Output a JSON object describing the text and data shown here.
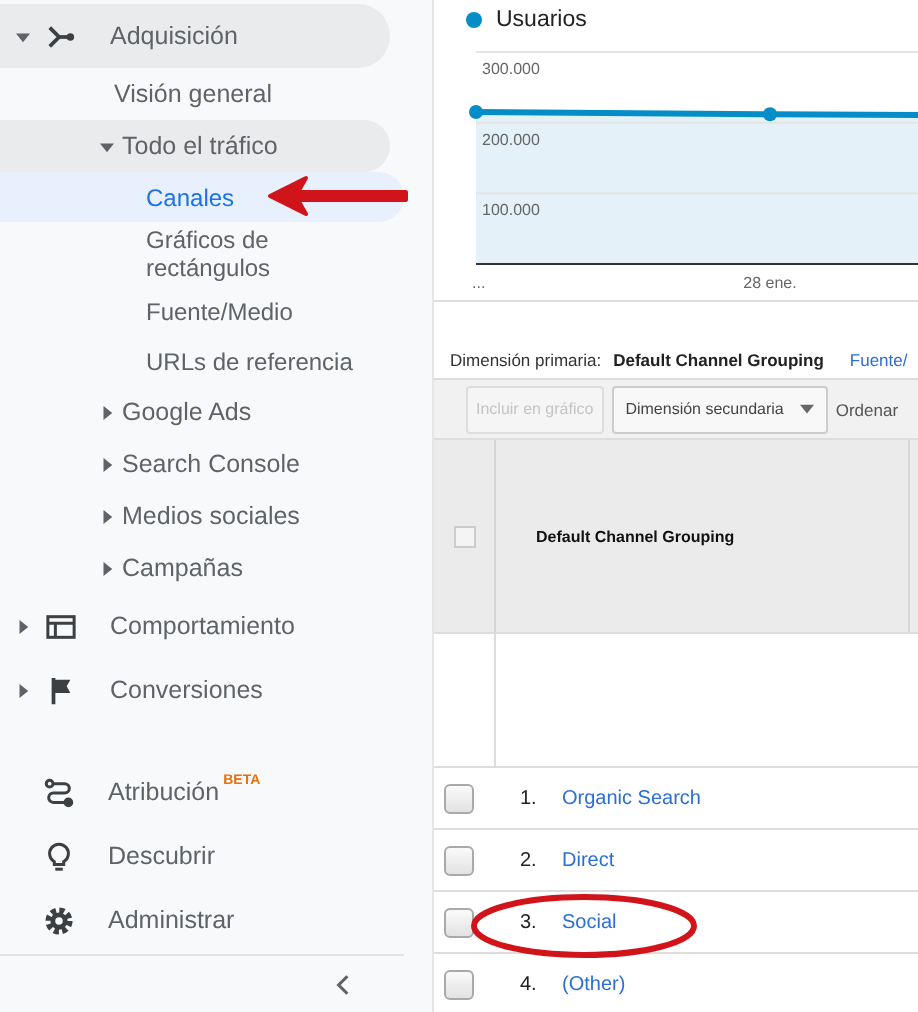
{
  "sidebar": {
    "items": [
      {
        "label": "Adquisición",
        "expanded": true,
        "selected": false,
        "children": [
          {
            "label": "Visión general",
            "selected": false
          },
          {
            "label": "Todo el tráfico",
            "expanded": true,
            "selected": false,
            "children": [
              {
                "label": "Canales",
                "selected": true
              },
              {
                "label": "Gráficos de rectángulos",
                "selected": false
              },
              {
                "label": "Fuente/Medio",
                "selected": false
              },
              {
                "label": "URLs de referencia",
                "selected": false
              }
            ]
          },
          {
            "label": "Google Ads",
            "expanded": false,
            "selected": false
          },
          {
            "label": "Search Console",
            "expanded": false,
            "selected": false
          },
          {
            "label": "Medios sociales",
            "expanded": false,
            "selected": false
          },
          {
            "label": "Campañas",
            "expanded": false,
            "selected": false
          }
        ]
      },
      {
        "label": "Comportamiento",
        "expanded": false,
        "selected": false
      },
      {
        "label": "Conversiones",
        "expanded": false,
        "selected": false
      }
    ],
    "tools": [
      {
        "label": "Atribución",
        "badge": "BETA",
        "selected": false
      },
      {
        "label": "Descubrir",
        "selected": false
      },
      {
        "label": "Administrar",
        "selected": false
      }
    ]
  },
  "chart": {
    "chart_data": {
      "type": "area",
      "categories": [
        "...",
        "28 ene.",
        null
      ],
      "ylim": [
        0,
        300000
      ],
      "grid": true,
      "series": [
        {
          "name": "Usuarios",
          "color": "#058dc7",
          "values": [
            215000,
            212000,
            210000
          ]
        }
      ],
      "yticks": [
        {
          "value": 100000,
          "label": "100.000"
        },
        {
          "value": 200000,
          "label": "200.000"
        },
        {
          "value": 300000,
          "label": "300.000"
        }
      ]
    }
  },
  "primary_dimension": {
    "label": "Dimensión primaria:",
    "value": "Default Channel Grouping",
    "other": "Fuente/"
  },
  "toolbar": {
    "plot_button": {
      "label": "Incluir en gráfico",
      "disabled": true
    },
    "secondary_dropdown": "Dimensión secundaria",
    "sort": "Ordenar"
  },
  "table": {
    "header_checked": false,
    "columns": [
      "Default Channel Grouping"
    ],
    "rows": [
      {
        "number": "1.",
        "channel": "Organic Search",
        "checked": false
      },
      {
        "number": "2.",
        "channel": "Direct",
        "checked": false
      },
      {
        "number": "3.",
        "channel": "Social",
        "checked": false
      },
      {
        "number": "4.",
        "channel": "(Other)",
        "checked": false
      }
    ]
  }
}
